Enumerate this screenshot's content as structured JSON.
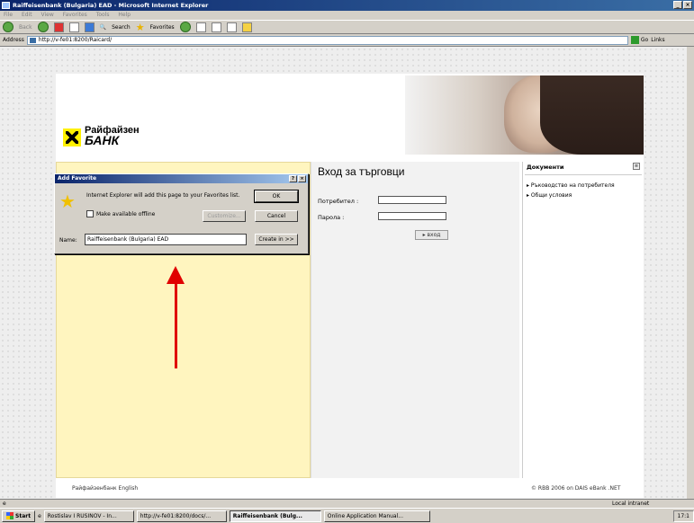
{
  "window": {
    "title": "Raiffeisenbank (Bulgaria) EAD - Microsoft Internet Explorer",
    "buttons": [
      "_",
      "×"
    ]
  },
  "menu": [
    "File",
    "Edit",
    "View",
    "Favorites",
    "Tools",
    "Help"
  ],
  "toolbar": {
    "back": "Back",
    "search": "Search",
    "favorites": "Favorites"
  },
  "address": {
    "label": "Address",
    "url": "http://v-fe01:8200/Raicard/",
    "go": "Go",
    "links": "Links"
  },
  "logo": {
    "line1": "Райфайзен",
    "line2": "БАНК"
  },
  "login": {
    "title": "Вход за търговци",
    "user_label": "Потребител :",
    "password_label": "Парола :",
    "submit": "▸ вход"
  },
  "documents": {
    "title": "Документи",
    "items": [
      "Ръководство на потребителя",
      "Общи условия"
    ]
  },
  "footer": {
    "left": "Райфайзенбанк   English",
    "right": "© RBB 2006 on DAIS eBank .NET"
  },
  "dialog": {
    "title": "Add Favorite",
    "message": "Internet Explorer will add this page to your Favorites list.",
    "offline_label": "Make available offline",
    "ok": "OK",
    "customize": "Customize...",
    "cancel": "Cancel",
    "name_label": "Name:",
    "name_value": "Raiffeisenbank (Bulgaria) EAD",
    "create_in": "Create in >>",
    "help_btn": "?",
    "close_btn": "×"
  },
  "status": {
    "zone": "Local intranet"
  },
  "taskbar": {
    "start": "Start",
    "tasks": [
      "Rostislav I RUSINOV - In...",
      "http://v-fe01:8200/docs/...",
      "Raiffeisenbank (Bulg...",
      "Online Application Manual..."
    ],
    "clock": "17:1"
  },
  "colors": {
    "titlebar": "#0a246a",
    "logo_yellow": "#fff100",
    "panel_yellow": "#fff5bf",
    "arrow": "#e00000"
  }
}
